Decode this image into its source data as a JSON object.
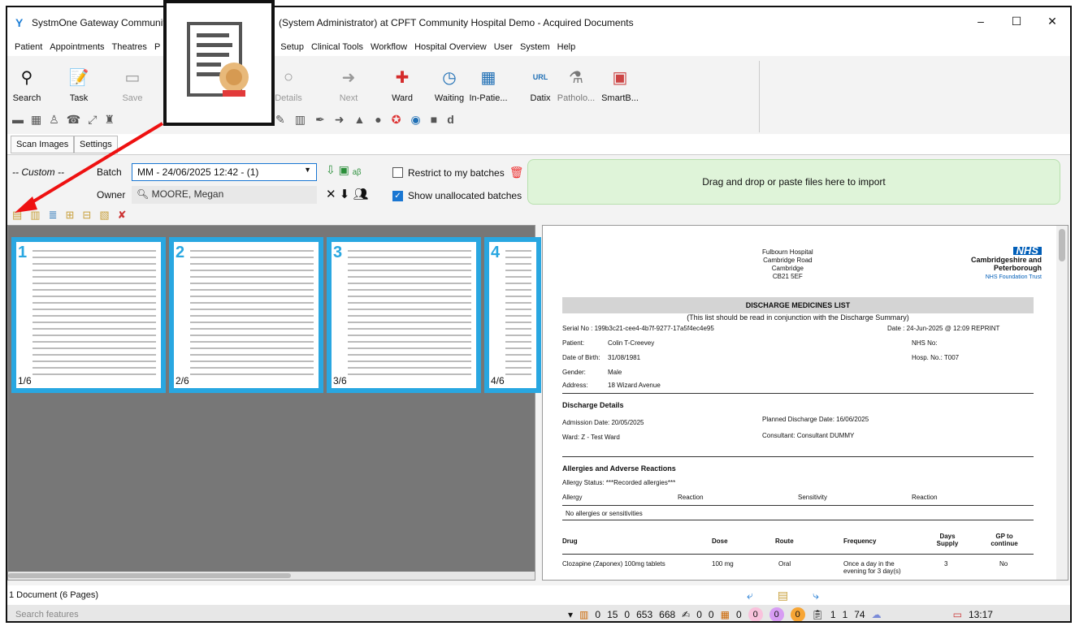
{
  "window": {
    "title_left": "SystmOne Gateway Community",
    "title_right": "(System Administrator) at CPFT Community Hospital Demo - Acquired Documents",
    "controls": [
      "–",
      "☐",
      "✕"
    ]
  },
  "menu": {
    "items_left": [
      "Patient",
      "Appointments",
      "Theatres",
      "P"
    ],
    "items_right": [
      "Setup",
      "Clinical Tools",
      "Workflow",
      "Hospital Overview",
      "User",
      "System",
      "Help"
    ]
  },
  "toolbar": {
    "buttons": [
      {
        "label": "Search",
        "icon": "search-icon",
        "glyph": "⚲"
      },
      {
        "label": "Task",
        "icon": "task-icon",
        "glyph": "📝"
      },
      {
        "label": "Save",
        "icon": "save-icon",
        "glyph": "▭"
      },
      {
        "label": "Details",
        "icon": "details-icon",
        "glyph": "○"
      },
      {
        "label": "Next",
        "icon": "next-icon",
        "glyph": "➜"
      },
      {
        "label": "Ward",
        "icon": "ward-icon",
        "glyph": "✚"
      },
      {
        "label": "Waiting",
        "icon": "waiting-icon",
        "glyph": "◷"
      },
      {
        "label": "In-Patie...",
        "icon": "inpatient-icon",
        "glyph": "▦"
      },
      {
        "label": "Datix",
        "icon": "datix-icon",
        "glyph": "URL"
      },
      {
        "label": "Patholo...",
        "icon": "pathology-icon",
        "glyph": "⚗"
      },
      {
        "label": "SmartB...",
        "icon": "smartboard-icon",
        "glyph": "▣"
      }
    ]
  },
  "tabs": [
    "Scan Images",
    "Settings"
  ],
  "controls": {
    "custom": "-- Custom --",
    "batch_label": "Batch",
    "batch_value": "MM - 24/06/2025 12:42 - (1)",
    "owner_label": "Owner",
    "owner_value": "MOORE, Megan",
    "restrict_label": "Restrict to my batches",
    "show_unallocated_label": "Show unallocated batches",
    "drop_text": "Drag and drop or paste files here to import"
  },
  "thumbnails": [
    {
      "num": "1",
      "count": "1/6"
    },
    {
      "num": "2",
      "count": "2/6"
    },
    {
      "num": "3",
      "count": "3/6"
    },
    {
      "num": "4",
      "count": "4/6"
    }
  ],
  "document": {
    "hospital": [
      "Fulbourn Hospital",
      "Cambridge Road",
      "Cambridge",
      "CB21 5EF"
    ],
    "nhs_logo": "NHS",
    "org": [
      "Cambridgeshire and",
      "Peterborough"
    ],
    "trust": "NHS Foundation Trust",
    "heading": "DISCHARGE MEDICINES LIST",
    "subheading": "(This list should be read in conjunction with the Discharge Summary)",
    "serial": "Serial No :  199b3c21-cee4-4b7f-9277-17a5f4ec4e95",
    "date": "Date :   24-Jun-2025   @  12:09  REPRINT",
    "patient_label": "Patient:",
    "patient": "Colin T-Creevey",
    "dob_label": "Date of Birth:",
    "dob": "31/08/1981",
    "gender_label": "Gender:",
    "gender": "Male",
    "address_label": "Address:",
    "address": "18 Wizard Avenue",
    "nhs_no": "NHS No:",
    "hosp_no": "Hosp. No.:  T007",
    "discharge_title": "Discharge Details",
    "admission": "Admission Date:   20/05/2025",
    "planned": "Planned Discharge Date:     16/06/2025",
    "ward": "Ward:   Z - Test Ward",
    "consultant": "Consultant:       Consultant DUMMY",
    "allergy_title": "Allergies and Adverse Reactions",
    "allergy_status": "Allergy Status:        ***Recorded allergies***",
    "col_allergy": "Allergy",
    "col_reaction": "Reaction",
    "col_sensitivity": "Sensitivity",
    "col_reaction2": "Reaction",
    "no_allergies": "No allergies or sensitivities",
    "drug_headers": [
      "Drug",
      "Dose",
      "Route",
      "Frequency",
      "Days Supply",
      "GP to continue"
    ],
    "drug_row": [
      "Clozapine (Zaponex) 100mg tablets",
      "100 mg",
      "Oral",
      "Once a day in the evening for 3 day(s)",
      "3",
      "No"
    ]
  },
  "status": {
    "doc_count": "1 Document (6 Pages)",
    "search_placeholder": "Search features",
    "stats": [
      "0",
      "15",
      "0",
      "653",
      "668",
      "0",
      "0",
      "0",
      "0",
      "0",
      "0",
      "1",
      "1",
      "74"
    ],
    "time": "13:17"
  }
}
